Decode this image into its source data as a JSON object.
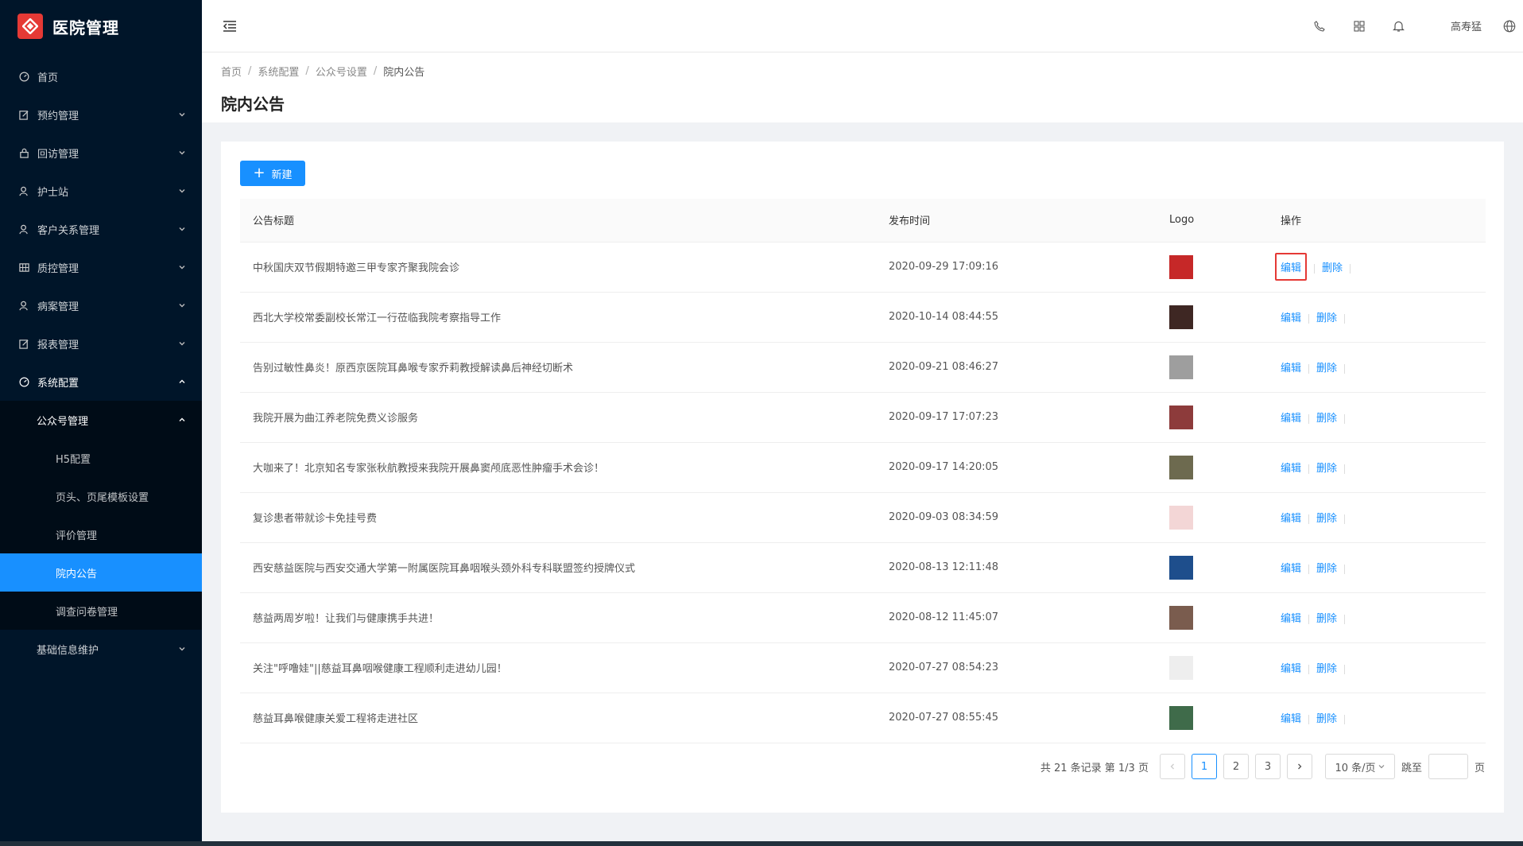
{
  "app": {
    "title": "医院管理"
  },
  "sidebar": {
    "items": [
      {
        "label": "首页",
        "icon": "dashboard-icon"
      },
      {
        "label": "预约管理",
        "icon": "edit-icon"
      },
      {
        "label": "回访管理",
        "icon": "lock-icon"
      },
      {
        "label": "护士站",
        "icon": "user-icon"
      },
      {
        "label": "客户关系管理",
        "icon": "user-icon"
      },
      {
        "label": "质控管理",
        "icon": "table-icon"
      },
      {
        "label": "病案管理",
        "icon": "user-icon"
      },
      {
        "label": "报表管理",
        "icon": "edit-icon"
      },
      {
        "label": "系统配置",
        "icon": "dashboard-icon"
      }
    ],
    "sub_group": "公众号管理",
    "sub_items": [
      "H5配置",
      "页头、页尾模板设置",
      "评价管理",
      "院内公告",
      "调查问卷管理"
    ],
    "active_sub": "院内公告",
    "last_item": "基础信息维护"
  },
  "header": {
    "user": "高寿猛"
  },
  "breadcrumb": [
    "首页",
    "系统配置",
    "公众号设置",
    "院内公告"
  ],
  "page_title": "院内公告",
  "toolbar": {
    "new_label": "新建"
  },
  "table": {
    "headers": [
      "公告标题",
      "发布时间",
      "Logo",
      "操作"
    ],
    "edit_label": "编辑",
    "delete_label": "删除",
    "rows": [
      {
        "title": "中秋国庆双节假期特邀三甲专家齐聚我院会诊",
        "time": "2020-09-29 17:09:16",
        "thumb": "#c62828"
      },
      {
        "title": "西北大学校常委副校长常江一行莅临我院考察指导工作",
        "time": "2020-10-14 08:44:55",
        "thumb": "#3e2723"
      },
      {
        "title": "告别过敏性鼻炎！原西京医院耳鼻喉专家乔莉教授解读鼻后神经切断术",
        "time": "2020-09-21 08:46:27",
        "thumb": "#9e9e9e"
      },
      {
        "title": "我院开展为曲江养老院免费义诊服务",
        "time": "2020-09-17 17:07:23",
        "thumb": "#8d3b3b"
      },
      {
        "title": "大咖来了！北京知名专家张秋航教授来我院开展鼻窦颅底恶性肿瘤手术会诊！",
        "time": "2020-09-17 14:20:05",
        "thumb": "#6d6a4f"
      },
      {
        "title": "复诊患者带就诊卡免挂号费",
        "time": "2020-09-03 08:34:59",
        "thumb": "#f3d6d6"
      },
      {
        "title": "西安慈益医院与西安交通大学第一附属医院耳鼻咽喉头颈外科专科联盟签约授牌仪式",
        "time": "2020-08-13 12:11:48",
        "thumb": "#1e4e8c"
      },
      {
        "title": "慈益两周岁啦！让我们与健康携手共进！",
        "time": "2020-08-12 11:45:07",
        "thumb": "#7a5c4e"
      },
      {
        "title": "关注\"呼噜娃\"||慈益耳鼻咽喉健康工程顺利走进幼儿园！",
        "time": "2020-07-27 08:54:23",
        "thumb": "#eeeeee"
      },
      {
        "title": "慈益耳鼻喉健康关爱工程将走进社区",
        "time": "2020-07-27 08:55:45",
        "thumb": "#3f6b4a"
      }
    ]
  },
  "pagination": {
    "total_text": "共 21 条记录 第 1/3 页",
    "pages": [
      "1",
      "2",
      "3"
    ],
    "current": "1",
    "page_size": "10 条/页",
    "jump_label": "跳至",
    "jump_unit": "页"
  },
  "colors": {
    "accent": "#1890ff",
    "sidebar_bg": "#001529",
    "highlight": "#e53935"
  }
}
